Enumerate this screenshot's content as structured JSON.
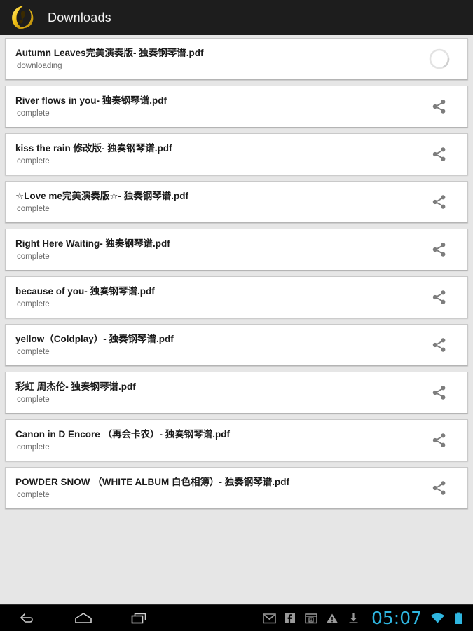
{
  "app_bar": {
    "title": "Downloads",
    "icon": "music-note-logo-icon",
    "background_color": "#1d1d1d",
    "title_color": "#f2f2f2",
    "logo_color": "#f2c700"
  },
  "downloads": {
    "items": [
      {
        "title": "Autumn Leaves完美演奏版- 独奏钢琴谱.pdf",
        "status": "downloading",
        "action": "progress-spinner"
      },
      {
        "title": "River flows in you- 独奏钢琴谱.pdf",
        "status": "complete",
        "action": "share"
      },
      {
        "title": "kiss the rain 修改版- 独奏钢琴谱.pdf",
        "status": "complete",
        "action": "share"
      },
      {
        "title": "☆Love me完美演奏版☆- 独奏钢琴谱.pdf",
        "status": "complete",
        "action": "share"
      },
      {
        "title": "Right Here Waiting- 独奏钢琴谱.pdf",
        "status": "complete",
        "action": "share"
      },
      {
        "title": "because of you- 独奏钢琴谱.pdf",
        "status": "complete",
        "action": "share"
      },
      {
        "title": "yellow（Coldplay）- 独奏钢琴谱.pdf",
        "status": "complete",
        "action": "share"
      },
      {
        "title": "彩虹 周杰伦- 独奏钢琴谱.pdf",
        "status": "complete",
        "action": "share"
      },
      {
        "title": "Canon in D Encore （再会卡农）- 独奏钢琴谱.pdf",
        "status": "complete",
        "action": "share"
      },
      {
        "title": "POWDER SNOW （WHITE ALBUM 白色相簿）- 独奏钢琴谱.pdf",
        "status": "complete",
        "action": "share"
      }
    ],
    "card_background": "#ffffff",
    "page_background": "#e6e6e6"
  },
  "system_bar": {
    "background_color": "#000000",
    "nav": [
      {
        "name": "back",
        "icon": "back-arrow-icon"
      },
      {
        "name": "home",
        "icon": "home-icon"
      },
      {
        "name": "recents",
        "icon": "recent-apps-icon"
      }
    ],
    "status_icons": [
      {
        "name": "gmail",
        "icon": "gmail-icon"
      },
      {
        "name": "facebook",
        "icon": "facebook-icon"
      },
      {
        "name": "calendar",
        "icon": "calendar-icon",
        "label": "1"
      },
      {
        "name": "warning",
        "icon": "warning-triangle-icon"
      },
      {
        "name": "download",
        "icon": "download-arrow-icon"
      }
    ],
    "clock": "05:07",
    "clock_color": "#2fb6e0",
    "wifi": "wifi-icon",
    "battery": "battery-full-icon",
    "battery_color": "#2fb6e0"
  }
}
